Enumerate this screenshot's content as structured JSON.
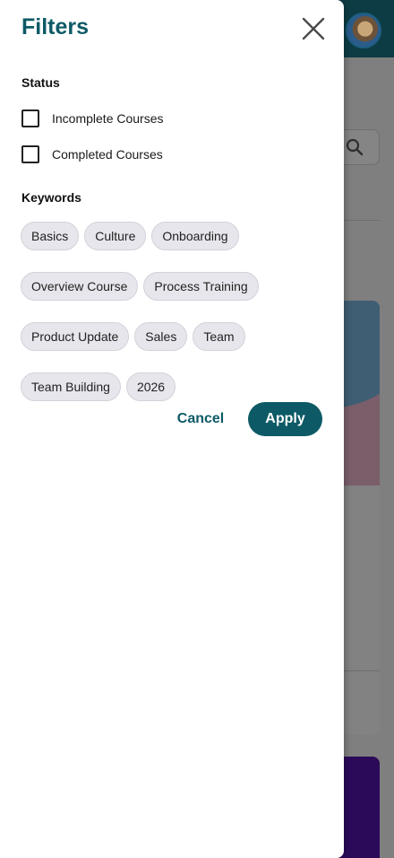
{
  "drawer": {
    "title": "Filters",
    "close_icon": "close-icon"
  },
  "status": {
    "label": "Status",
    "options": [
      {
        "label": "Incomplete Courses",
        "checked": false
      },
      {
        "label": "Completed Courses",
        "checked": false
      }
    ]
  },
  "keywords": {
    "label": "Keywords",
    "chips": [
      "Basics",
      "Culture",
      "Onboarding",
      "Overview Course",
      "Process Training",
      "Product Update",
      "Sales",
      "Team",
      "Team Building",
      "2026"
    ]
  },
  "actions": {
    "cancel_label": "Cancel",
    "apply_label": "Apply"
  },
  "background": {
    "search_icon": "search-icon",
    "avatar": "avatar"
  },
  "colors": {
    "accent": "#0d5a66",
    "header": "#0d3c44",
    "chip_bg": "#e6e6ec"
  }
}
